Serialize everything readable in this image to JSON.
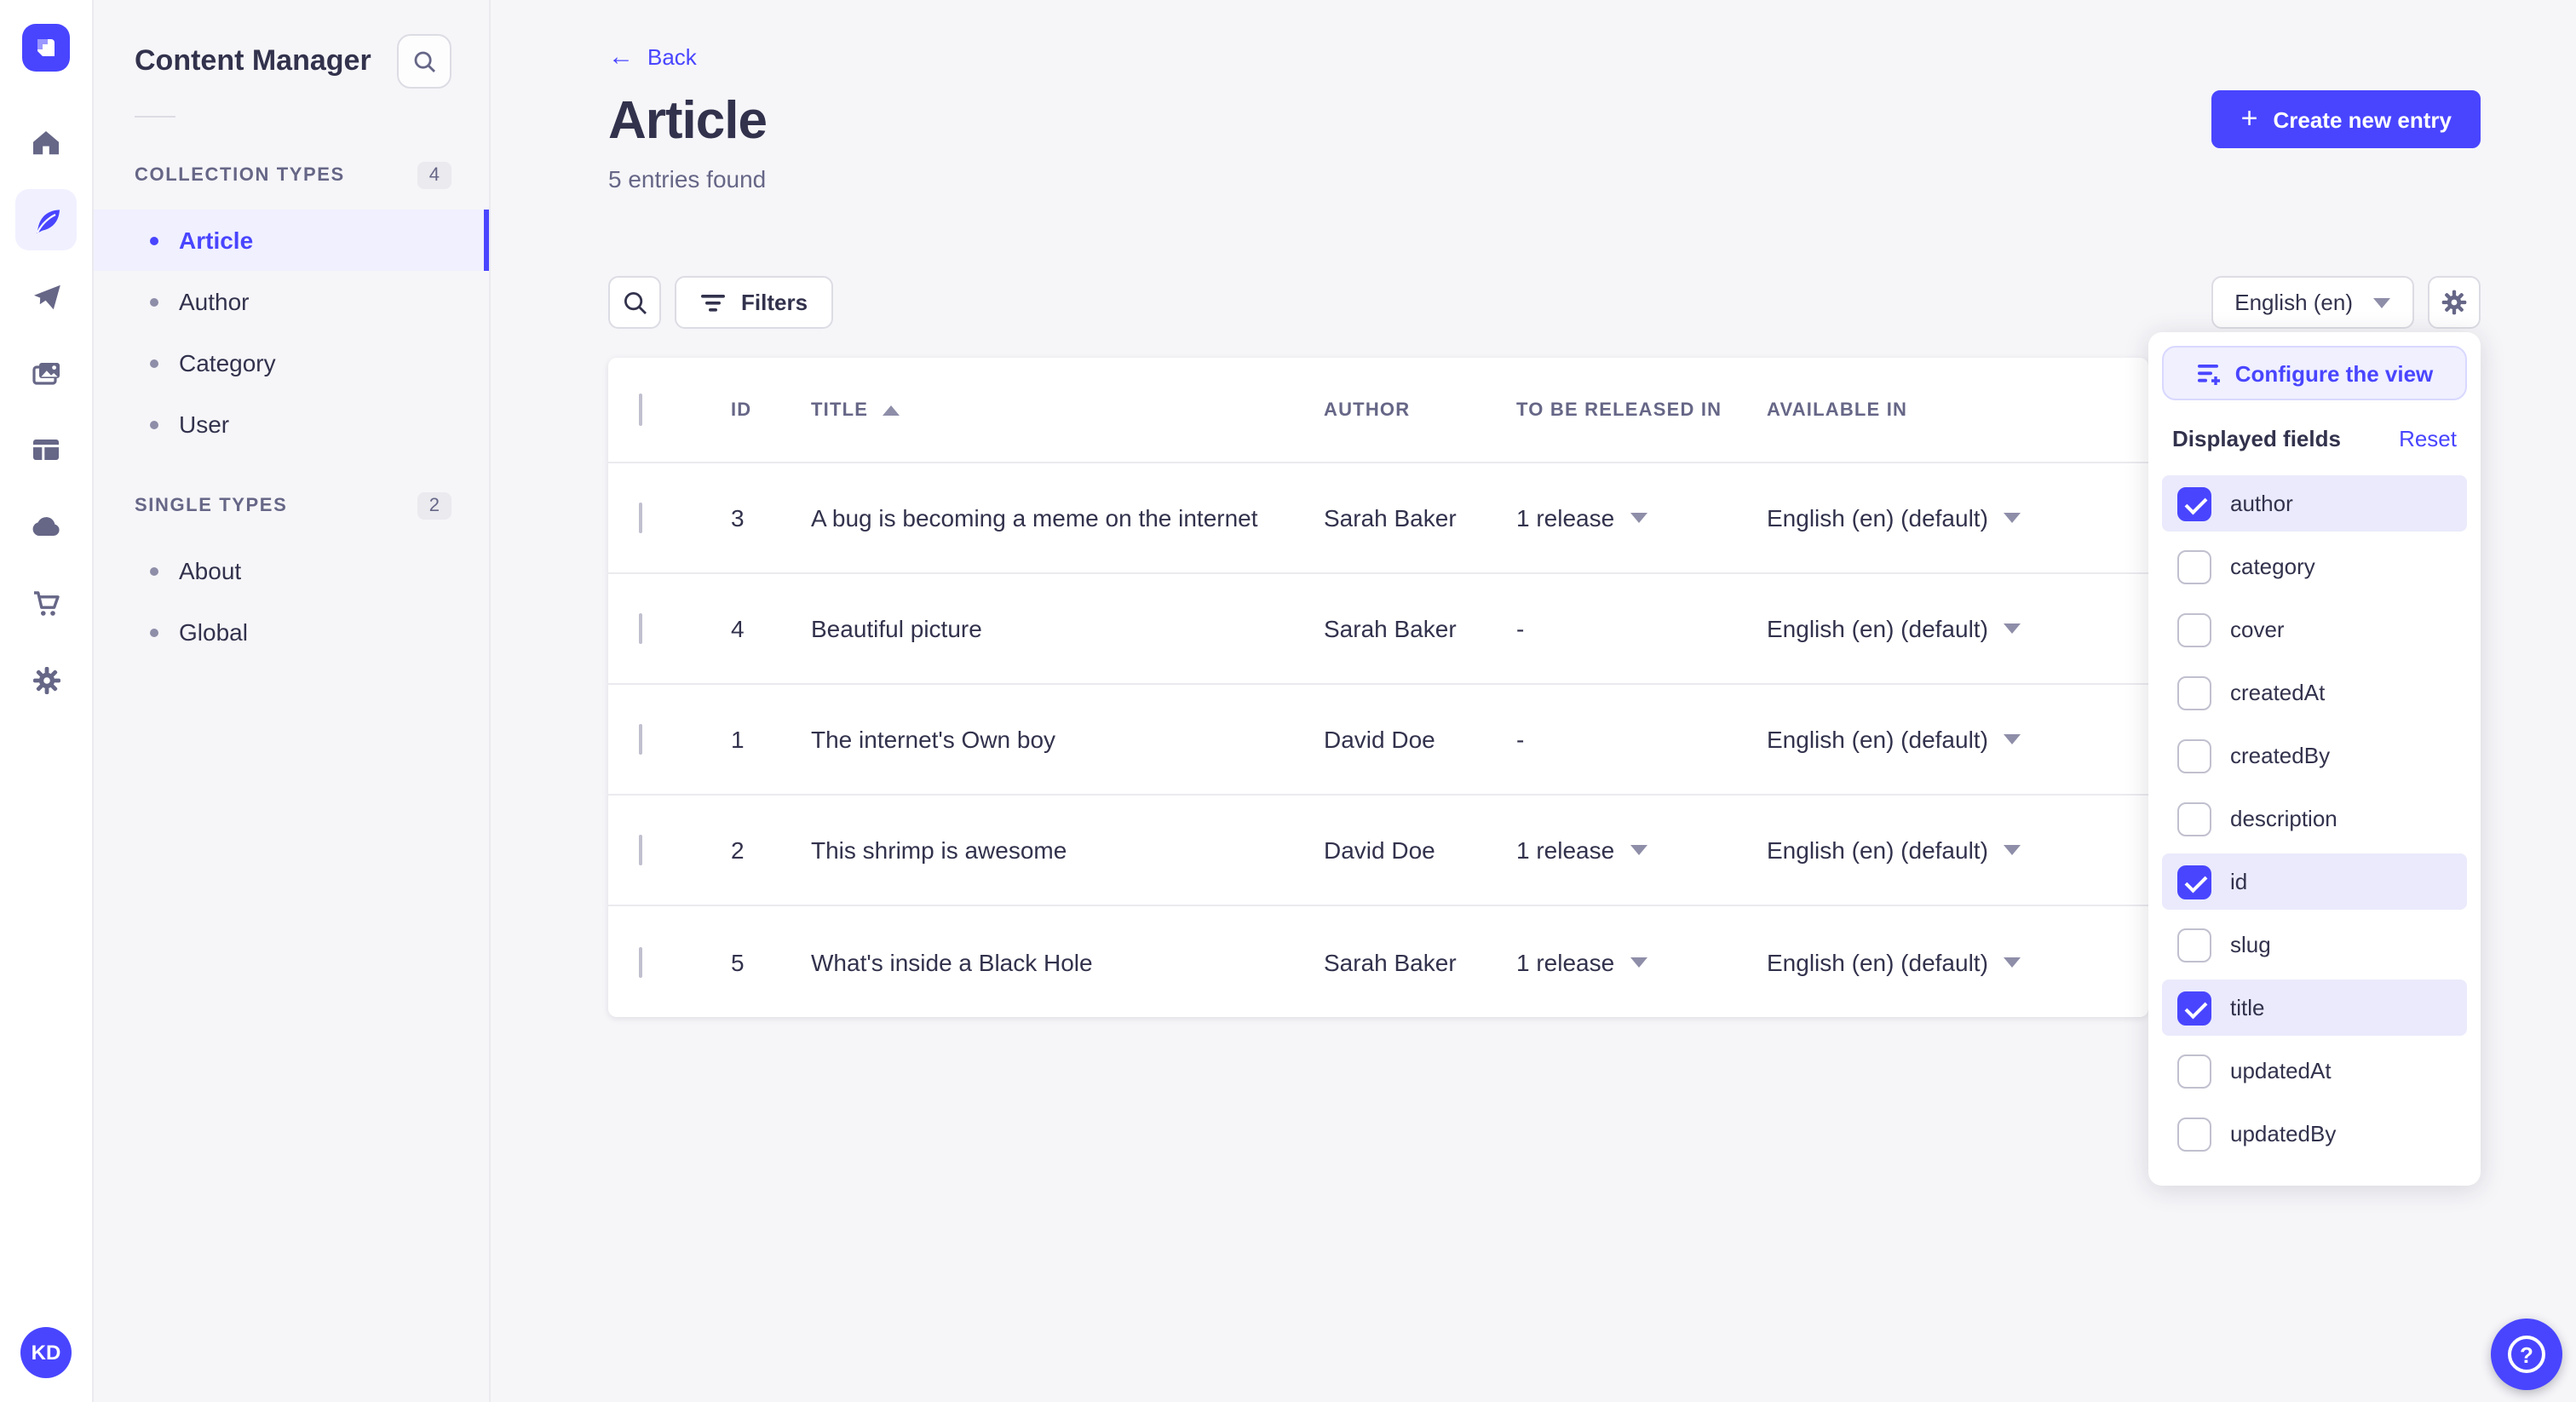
{
  "colors": {
    "primary": "#4945ff",
    "primary_light": "#f0f0ff",
    "text": "#32324d",
    "muted": "#666687"
  },
  "nav_rail": {
    "logo_icon": "strapi-logo",
    "icons": [
      {
        "name": "home-icon",
        "active": false
      },
      {
        "name": "content-manager-feather-icon",
        "active": true
      },
      {
        "name": "paper-plane-icon",
        "active": false
      },
      {
        "name": "media-library-images-icon",
        "active": false
      },
      {
        "name": "layout-icon",
        "active": false
      },
      {
        "name": "cloud-icon",
        "active": false
      },
      {
        "name": "marketplace-cart-icon",
        "active": false
      },
      {
        "name": "settings-gear-icon",
        "active": false
      }
    ],
    "avatar_initials": "KD"
  },
  "sidebar": {
    "title": "Content Manager",
    "search_icon": "search-icon",
    "collection_section": {
      "label": "COLLECTION TYPES",
      "badge": "4"
    },
    "collection_items": [
      {
        "label": "Article",
        "active": true
      },
      {
        "label": "Author",
        "active": false
      },
      {
        "label": "Category",
        "active": false
      },
      {
        "label": "User",
        "active": false
      }
    ],
    "single_section": {
      "label": "SINGLE TYPES",
      "badge": "2"
    },
    "single_items": [
      {
        "label": "About",
        "active": false
      },
      {
        "label": "Global",
        "active": false
      }
    ]
  },
  "header": {
    "back_label": "Back",
    "title": "Article",
    "subtitle": "5 entries found",
    "create_button": "Create new entry"
  },
  "toolbar": {
    "filters_label": "Filters",
    "locale_label": "English (en)"
  },
  "table": {
    "columns": {
      "id": "ID",
      "title": "TITLE",
      "author": "AUTHOR",
      "released": "TO BE RELEASED IN",
      "available": "AVAILABLE IN"
    },
    "rows": [
      {
        "id": "3",
        "title": "A bug is becoming a meme on the internet",
        "author": "Sarah Baker",
        "released": "1 release",
        "released_menu": true,
        "available": "English (en) (default)"
      },
      {
        "id": "4",
        "title": "Beautiful picture",
        "author": "Sarah Baker",
        "released": "-",
        "released_menu": false,
        "available": "English (en) (default)"
      },
      {
        "id": "1",
        "title": "The internet's Own boy",
        "author": "David Doe",
        "released": "-",
        "released_menu": false,
        "available": "English (en) (default)"
      },
      {
        "id": "2",
        "title": "This shrimp is awesome",
        "author": "David Doe",
        "released": "1 release",
        "released_menu": true,
        "available": "English (en) (default)"
      },
      {
        "id": "5",
        "title": "What's inside a Black Hole",
        "author": "Sarah Baker",
        "released": "1 release",
        "released_menu": true,
        "available": "English (en) (default)"
      }
    ]
  },
  "popover": {
    "configure_label": "Configure the view",
    "configure_icon": "configure-lines-plus-icon",
    "fields_heading": "Displayed fields",
    "reset_label": "Reset",
    "fields": [
      {
        "label": "author",
        "checked": true
      },
      {
        "label": "category",
        "checked": false
      },
      {
        "label": "cover",
        "checked": false
      },
      {
        "label": "createdAt",
        "checked": false
      },
      {
        "label": "createdBy",
        "checked": false
      },
      {
        "label": "description",
        "checked": false
      },
      {
        "label": "id",
        "checked": true
      },
      {
        "label": "slug",
        "checked": false
      },
      {
        "label": "title",
        "checked": true
      },
      {
        "label": "updatedAt",
        "checked": false
      },
      {
        "label": "updatedBy",
        "checked": false
      }
    ]
  },
  "help_button": {
    "icon": "question-mark-icon"
  }
}
